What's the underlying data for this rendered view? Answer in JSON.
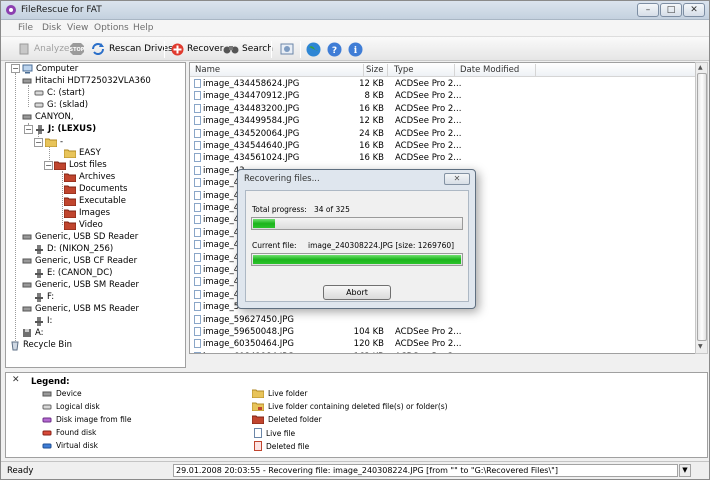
{
  "window": {
    "title": "FileRescue for FAT",
    "min_glyph": "–",
    "max_glyph": "□",
    "close_glyph": "✕"
  },
  "menu": [
    "File",
    "Disk",
    "View",
    "Options",
    "Help"
  ],
  "toolbar": {
    "analyze": "Analyze",
    "stop": "STOP",
    "rescan": "Rescan Drives",
    "recover": "Recover",
    "search": "Search"
  },
  "tree": {
    "computer": "Computer",
    "disk1": "Hitachi HDT725032VLA360",
    "c": "C: (start)",
    "g": "G: (sklad)",
    "canyon": "CANYON,",
    "j": "J: (LEXUS)",
    "dash": "-",
    "easy": "EASY",
    "lost": "Lost files",
    "archives": "Archives",
    "documents": "Documents",
    "executable": "Executable",
    "images": "Images",
    "video": "Video",
    "sd": "Generic, USB SD Reader",
    "d": "D: (NIKON_256)",
    "cf": "Generic, USB CF Reader",
    "e": "E: (CANON_DC)",
    "sm": "Generic, USB SM Reader",
    "f": "F:",
    "ms": "Generic, USB MS Reader",
    "i": "I:",
    "a": "A:",
    "recycle": "Recycle Bin"
  },
  "file_list": {
    "columns": {
      "name": "Name",
      "size": "Size",
      "type": "Type",
      "date": "Date Modified"
    },
    "rows": [
      {
        "name": "image_434458624.JPG",
        "size": "12 KB",
        "type": "ACDSee Pro 2..."
      },
      {
        "name": "image_434470912.JPG",
        "size": "8 KB",
        "type": "ACDSee Pro 2..."
      },
      {
        "name": "image_434483200.JPG",
        "size": "16 KB",
        "type": "ACDSee Pro 2..."
      },
      {
        "name": "image_434499584.JPG",
        "size": "12 KB",
        "type": "ACDSee Pro 2..."
      },
      {
        "name": "image_434520064.JPG",
        "size": "24 KB",
        "type": "ACDSee Pro 2..."
      },
      {
        "name": "image_434544640.JPG",
        "size": "16 KB",
        "type": "ACDSee Pro 2..."
      },
      {
        "name": "image_434561024.JPG",
        "size": "16 KB",
        "type": "ACDSee Pro 2..."
      },
      {
        "name": "image_43",
        "size": "",
        "type": ""
      },
      {
        "name": "image_43",
        "size": "",
        "type": ""
      },
      {
        "name": "image_43",
        "size": "",
        "type": ""
      },
      {
        "name": "image_43",
        "size": "",
        "type": ""
      },
      {
        "name": "image_43",
        "size": "",
        "type": ""
      },
      {
        "name": "image_43",
        "size": "",
        "type": ""
      },
      {
        "name": "image_43",
        "size": "",
        "type": ""
      },
      {
        "name": "image_43",
        "size": "",
        "type": ""
      },
      {
        "name": "image_43",
        "size": "",
        "type": ""
      },
      {
        "name": "image_43",
        "size": "",
        "type": ""
      },
      {
        "name": "image_45",
        "size": "",
        "type": ""
      },
      {
        "name": "image_58",
        "size": "",
        "type": ""
      },
      {
        "name": "image_59627450.JPG",
        "size": "",
        "type": ""
      },
      {
        "name": "image_59650048.JPG",
        "size": "104 KB",
        "type": "ACDSee Pro 2..."
      },
      {
        "name": "image_60350464.JPG",
        "size": "120 KB",
        "type": "ACDSee Pro 2..."
      },
      {
        "name": "image_60841984.JPG",
        "size": "162 KB",
        "type": "ACDSee Pro 2..."
      }
    ]
  },
  "legend": {
    "title": "Legend:",
    "close_glyph": "✕",
    "left": [
      "Device",
      "Logical disk",
      "Disk image from file",
      "Found disk",
      "Virtual disk"
    ],
    "right": [
      "Live folder",
      "Live folder containing deleted file(s) or folder(s)",
      "Deleted folder",
      "Live file",
      "Deleted file"
    ]
  },
  "status": {
    "ready": "Ready",
    "message": "29.01.2008 20:03:55 - Recovering file: image_240308224.JPG [from \"\" to \"G:\\Recovered Files\\\"]",
    "dropdown_glyph": "▼"
  },
  "dialog": {
    "title": "Recovering files...",
    "close_glyph": "✕",
    "total_label": "Total progress:",
    "total_value": "34 of 325",
    "total_fraction": 0.105,
    "current_label": "Current file:",
    "current_value": "image_240308224.JPG [size: 1269760]",
    "current_fraction": 1.0,
    "abort": "Abort"
  },
  "colors": {
    "progress_green": "#1cb41c",
    "folder": "#e8c45a",
    "deleted_folder": "#c0452e"
  }
}
